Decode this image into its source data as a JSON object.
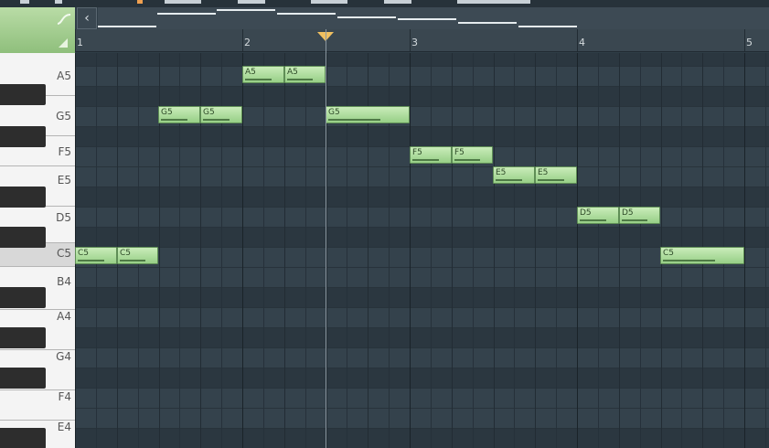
{
  "ruler": {
    "bars": [
      "1",
      "2",
      "3",
      "4",
      "5"
    ]
  },
  "keyboard": {
    "labels": [
      "A5",
      "G5",
      "F5",
      "E5",
      "D5",
      "C5",
      "B4",
      "A4",
      "G4",
      "F4",
      "E4"
    ]
  },
  "notes": [
    "A5",
    "A5",
    "G5",
    "G5",
    "G5",
    "F5",
    "F5",
    "E5",
    "E5",
    "D5",
    "D5",
    "C5",
    "C5",
    "C5"
  ],
  "icons": {
    "scroll_left": "chevron-left-icon",
    "tool": "curve-tool-icon"
  },
  "colors": {
    "note_fill": "#a8dc96",
    "background": "#2f3d47",
    "playhead": "#f0c060"
  }
}
